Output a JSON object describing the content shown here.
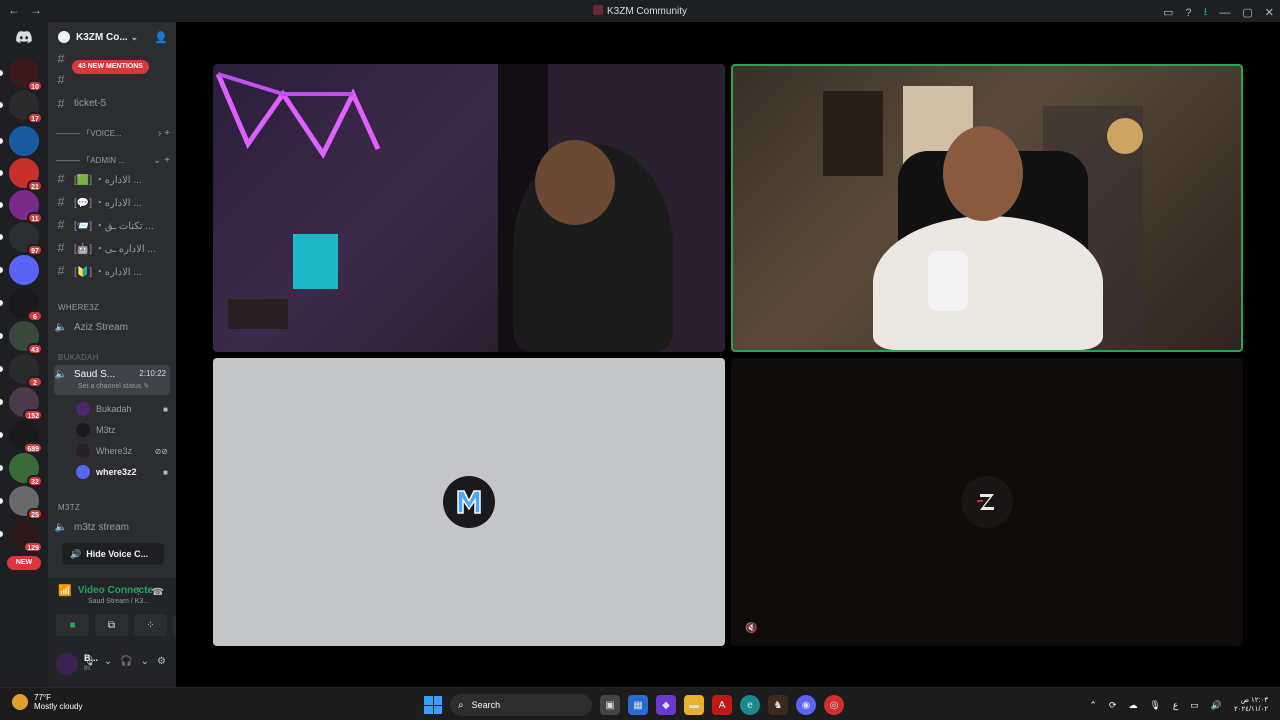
{
  "window": {
    "title": "K3ZM Community",
    "back": "←",
    "forward": "→"
  },
  "rail": {
    "servers": [
      {
        "badge": "10",
        "color": "#3b1a1a"
      },
      {
        "badge": "17",
        "color": "#2a2a2a"
      },
      {
        "badge": "",
        "color": "#1a5aa0"
      },
      {
        "badge": "21",
        "color": "#c9302c"
      },
      {
        "badge": "11",
        "color": "#7a2a8a"
      },
      {
        "badge": "97",
        "color": "#2b2d31"
      },
      {
        "badge": "",
        "color": "#5865f2"
      },
      {
        "badge": "6",
        "color": "#1a1a1e"
      },
      {
        "badge": "43",
        "color": "#3a4a3a"
      },
      {
        "badge": "2",
        "color": "#2a2a2a"
      },
      {
        "badge": "152",
        "color": "#4a3a4a"
      },
      {
        "badge": "689",
        "color": "#1a1a1a"
      },
      {
        "badge": "32",
        "color": "#3a6a3a"
      },
      {
        "badge": "25",
        "color": "#6a6a6a"
      },
      {
        "badge": "129",
        "color": "#2a1a1a"
      }
    ],
    "new_label": "NEW"
  },
  "sidebar": {
    "server_name": "K3ZM Co...",
    "mentions_label": "43 NEW MENTIONS",
    "channels_top": [
      {
        "name": "ticket-5"
      }
    ],
    "categories": [
      {
        "label": "――― 「VOICE..."
      },
      {
        "label": "――― 「ADMIN ..."
      }
    ],
    "admin_channels": [
      {
        "name": "[🟩] ・الاداره ..."
      },
      {
        "name": "[💬] ・الاداره ..."
      },
      {
        "name": "[📨] ・تكتات ـق ..."
      },
      {
        "name": "[🤖] ・الاداره ـى ..."
      },
      {
        "name": "[🔰] ・الاداره ..."
      }
    ],
    "section_where3z": "WHERE3Z",
    "voice_aziz": "Aziz Stream",
    "section_bukadah": "BUKADAH",
    "active_voice": {
      "name": "Saud S...",
      "timer": "2:10:22",
      "status": "Set a channel status"
    },
    "users": [
      {
        "name": "Bukadah",
        "icon": "video-icon"
      },
      {
        "name": "M3tz",
        "icon": ""
      },
      {
        "name": "Where3z",
        "icon": "muted-deafened-icon"
      },
      {
        "name": "where3z2",
        "icon": "video-icon"
      }
    ],
    "section_m3tz": "M3TZ",
    "voice_m3tz": "m3tz stream",
    "hide_voice": "Hide Voice C..."
  },
  "voice_panel": {
    "title": "Video Connecte",
    "subtitle": "Saud Stream / K3...",
    "buttons": [
      "camera-icon",
      "screen-share-icon",
      "activities-icon",
      "soundboard-icon"
    ]
  },
  "user_area": {
    "name": "B...",
    "status": "In"
  },
  "taskbar": {
    "temp": "77°F",
    "weather": "Mostly cloudy",
    "search_label": "Search",
    "clock_time": "١٢:٠٣ ص",
    "clock_date": "٢٠٢٤/١١/٠٢"
  }
}
